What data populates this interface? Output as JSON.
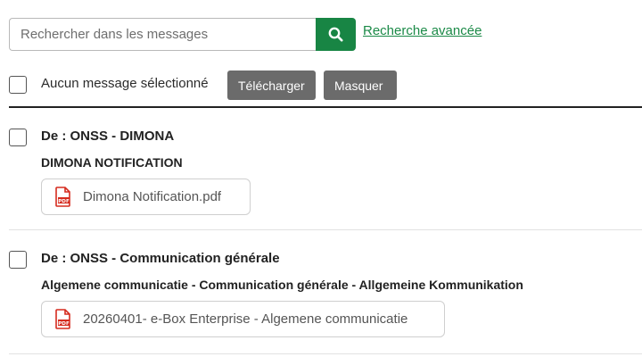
{
  "search": {
    "placeholder": "Rechercher dans les messages",
    "value": "",
    "button_icon": "search-icon",
    "advanced_link": "Recherche avancée"
  },
  "toolbar": {
    "selection_text": "Aucun message sélectionné",
    "download_label": "Télécharger",
    "hide_label": "Masquer"
  },
  "messages": [
    {
      "from": "De : ONSS - DIMONA",
      "subject": "DIMONA NOTIFICATION",
      "attachment": {
        "icon": "pdf-icon",
        "name": "Dimona Notification.pdf"
      }
    },
    {
      "from": "De : ONSS - Communication générale",
      "subject": "Algemene communicatie - Communication générale - Allgemeine Kommunikation",
      "attachment": {
        "icon": "pdf-icon",
        "name": "20260401- e-Box Enterprise - Algemene communicatie"
      }
    }
  ],
  "colors": {
    "accent_green": "#188544",
    "link_green": "#1b8a47",
    "button_grey": "#6b6b6b",
    "pdf_red": "#d52b1e"
  }
}
